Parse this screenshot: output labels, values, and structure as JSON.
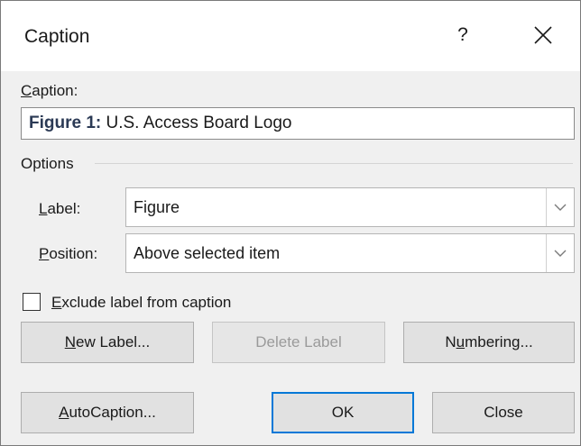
{
  "window": {
    "title": "Caption",
    "help_label": "?"
  },
  "caption": {
    "label_prefix": "",
    "label_mnemonic": "C",
    "label_rest": "aption:",
    "value_bold": "Figure 1:",
    "value_text": " U.S. Access Board Logo"
  },
  "options": {
    "group_label": "Options",
    "label_field": {
      "mnemonic": "L",
      "rest": "abel:",
      "selected": "Figure"
    },
    "position_field": {
      "mnemonic": "P",
      "rest": "osition:",
      "selected": "Above selected item"
    },
    "exclude": {
      "checked": false,
      "mnemonic": "E",
      "rest": "xclude label from caption"
    }
  },
  "buttons": {
    "new_label": {
      "mnemonic": "N",
      "rest": "ew Label..."
    },
    "delete_label": {
      "text": "Delete Label"
    },
    "numbering": {
      "before": "N",
      "mnemonic": "u",
      "rest": "mbering..."
    },
    "autocaption": {
      "mnemonic": "A",
      "rest": "utoCaption..."
    },
    "ok": {
      "text": "OK"
    },
    "close": {
      "text": "Close"
    }
  },
  "colors": {
    "accent": "#0078d7",
    "dialog_bg": "#f0f0f0"
  }
}
